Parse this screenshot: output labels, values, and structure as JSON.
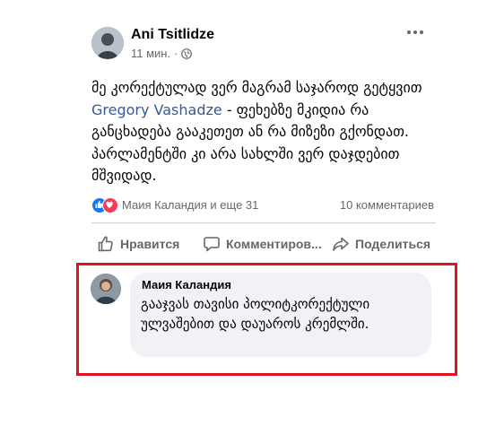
{
  "post": {
    "author": "Ani Tsitlidze",
    "time": "11 мин.",
    "dot": "·",
    "text_before_mention": "მე კორექტულად ვერ მაგრამ საჯაროდ გეტყვით ",
    "mention": "Gregory  Vashadze",
    "text_after_mention": " - ფეხებზე მკიდია რა განცხადება გააკეთეთ ან რა მიზეზი გქონდათ. პარლამენტში კი არა სახლში ვერ დაჯდებით მშვიდად.",
    "privacy_icon": "globe-icon",
    "more_icon": "more-options-icon"
  },
  "reactions": {
    "names": "Маия Каландия и еще 31",
    "comments_count": "10 комментариев",
    "icons": [
      "like-reaction-icon",
      "love-reaction-icon"
    ]
  },
  "actions": {
    "like": "Нравится",
    "comment": "Комментиров...",
    "share": "Поделиться"
  },
  "comment": {
    "author": "Маия Каландия",
    "text": "გააჯვას თავისი პოლიტკორექტული ულვაშებით და დაუაროს კრემლში."
  },
  "colors": {
    "mention": "#385898",
    "like": "#1877f2",
    "love": "#f33e58",
    "highlight": "#e0141e",
    "bubble": "#f0f2f5",
    "secondary_text": "#65676b"
  }
}
